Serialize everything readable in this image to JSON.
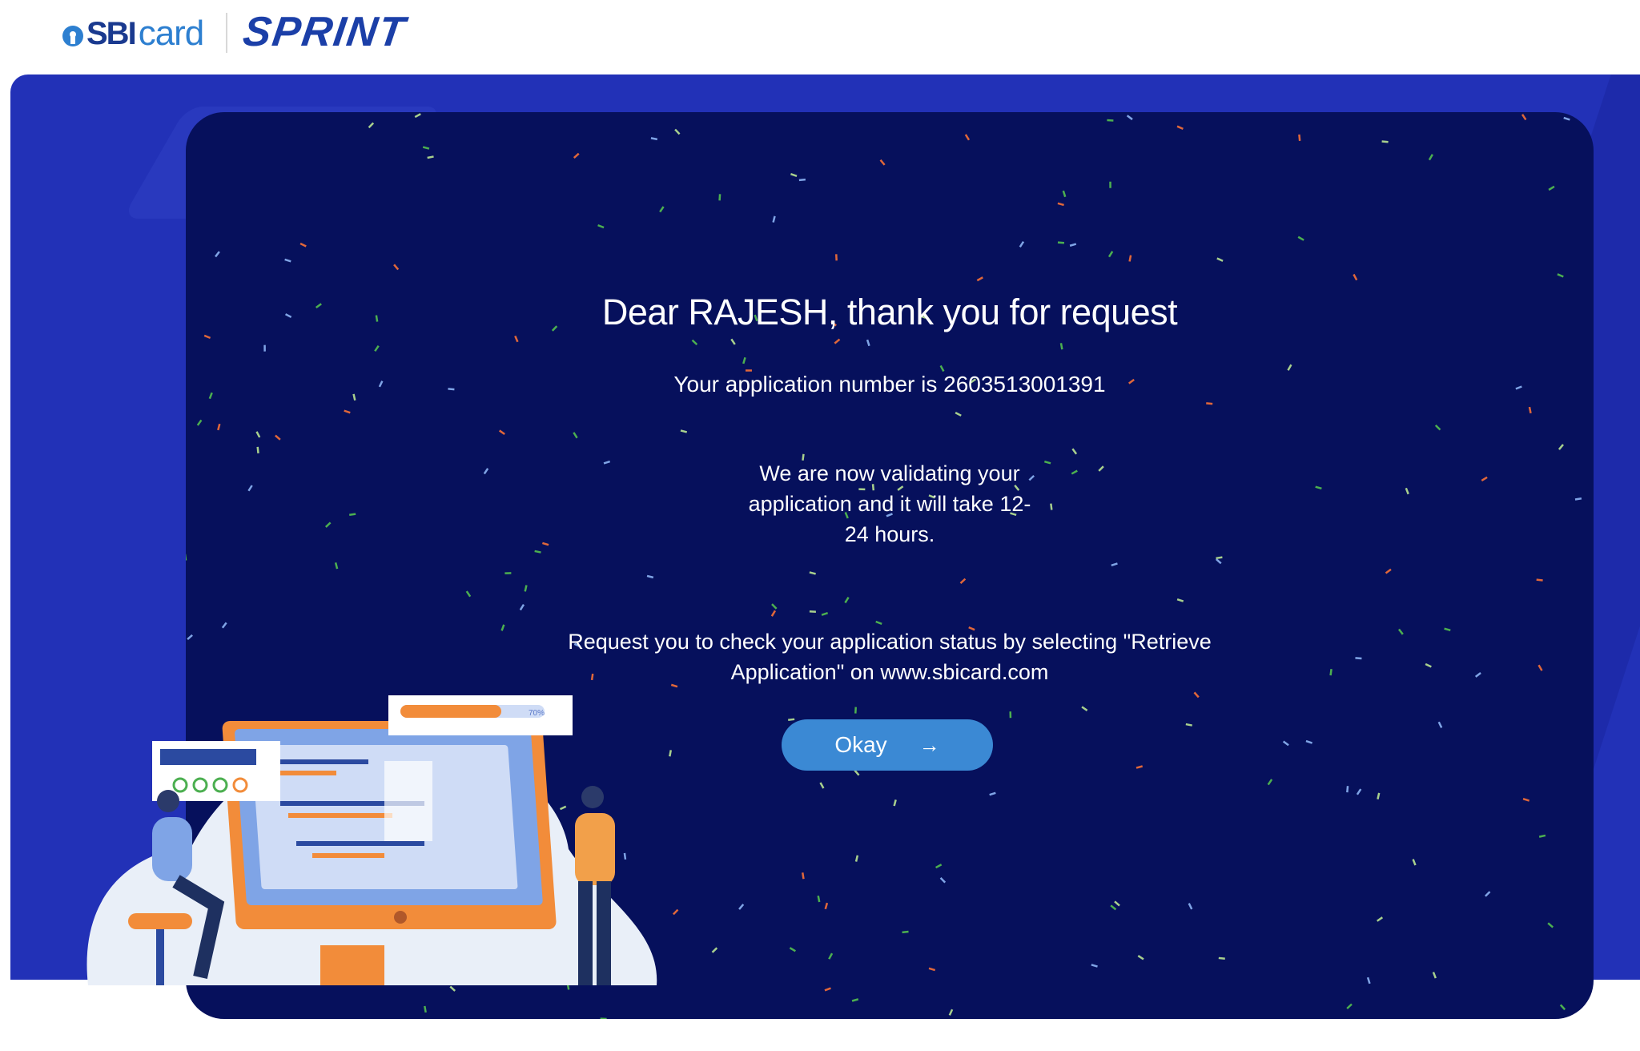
{
  "header": {
    "brand_sbi": "SBI",
    "brand_card": "card",
    "product": "SPRINT"
  },
  "message": {
    "title": "Dear RAJESH, thank you for request",
    "application_number": "Your application number is 2603513001391",
    "validating": "We are now validating your application and it will take 12-24 hours.",
    "request": "Request you to check your application status by selecting \"Retrieve Application\" on www.sbicard.com",
    "okay_label": "Okay",
    "okay_icon": "arrow-right-icon"
  },
  "illustration": {
    "progress_label": "70%",
    "progress_value": 0.7
  },
  "colors": {
    "band": "#2231b7",
    "card": "#06105c",
    "button": "#3b89d4",
    "brand_blue": "#1b3fa8"
  }
}
